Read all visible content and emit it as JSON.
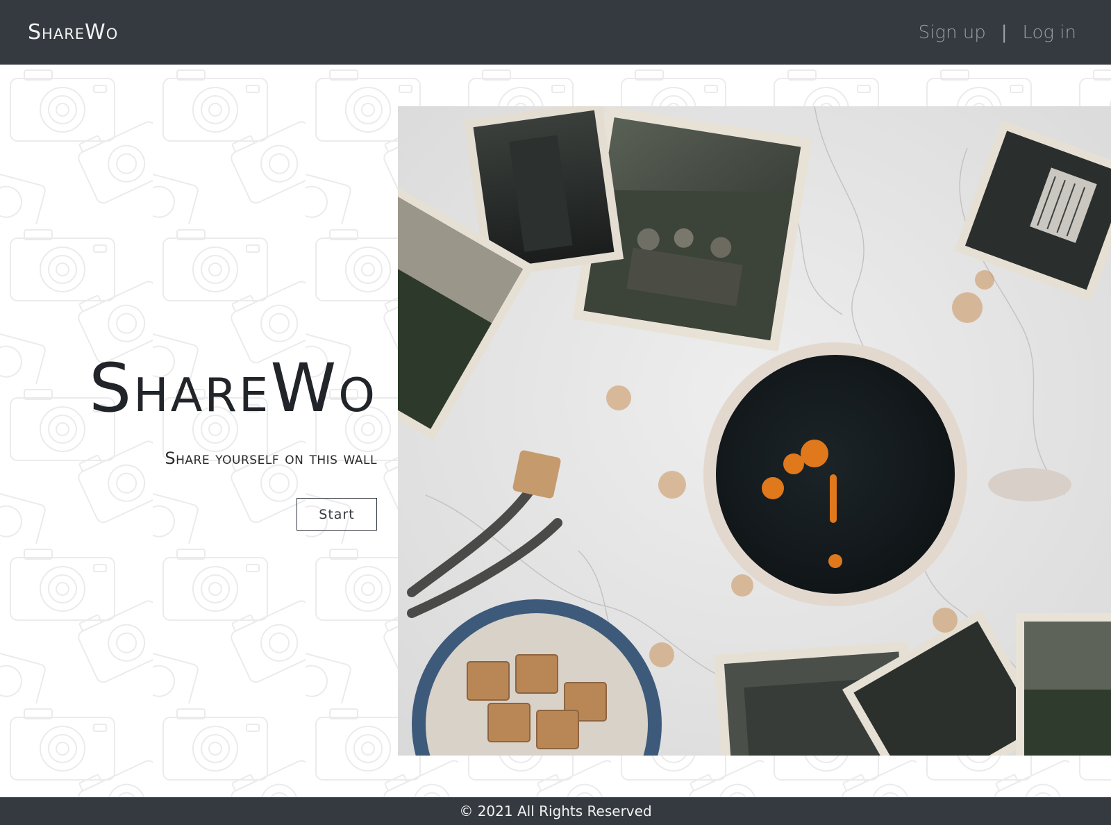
{
  "navbar": {
    "brand": "ShareWo",
    "signup_label": "Sign up",
    "separator": "|",
    "login_label": "Log in"
  },
  "hero": {
    "title": "ShareWo",
    "subtitle": "Share yourself on this wall",
    "start_label": "Start",
    "photo_icon": "hero-photo-coffee-and-vintage-photos"
  },
  "footer": {
    "copyright": "© 2021 All Rights Reserved"
  },
  "colors": {
    "navbar_bg": "#343a40",
    "footer_bg": "#343a40",
    "nav_link": "#9aa0a6",
    "title": "#212529"
  }
}
